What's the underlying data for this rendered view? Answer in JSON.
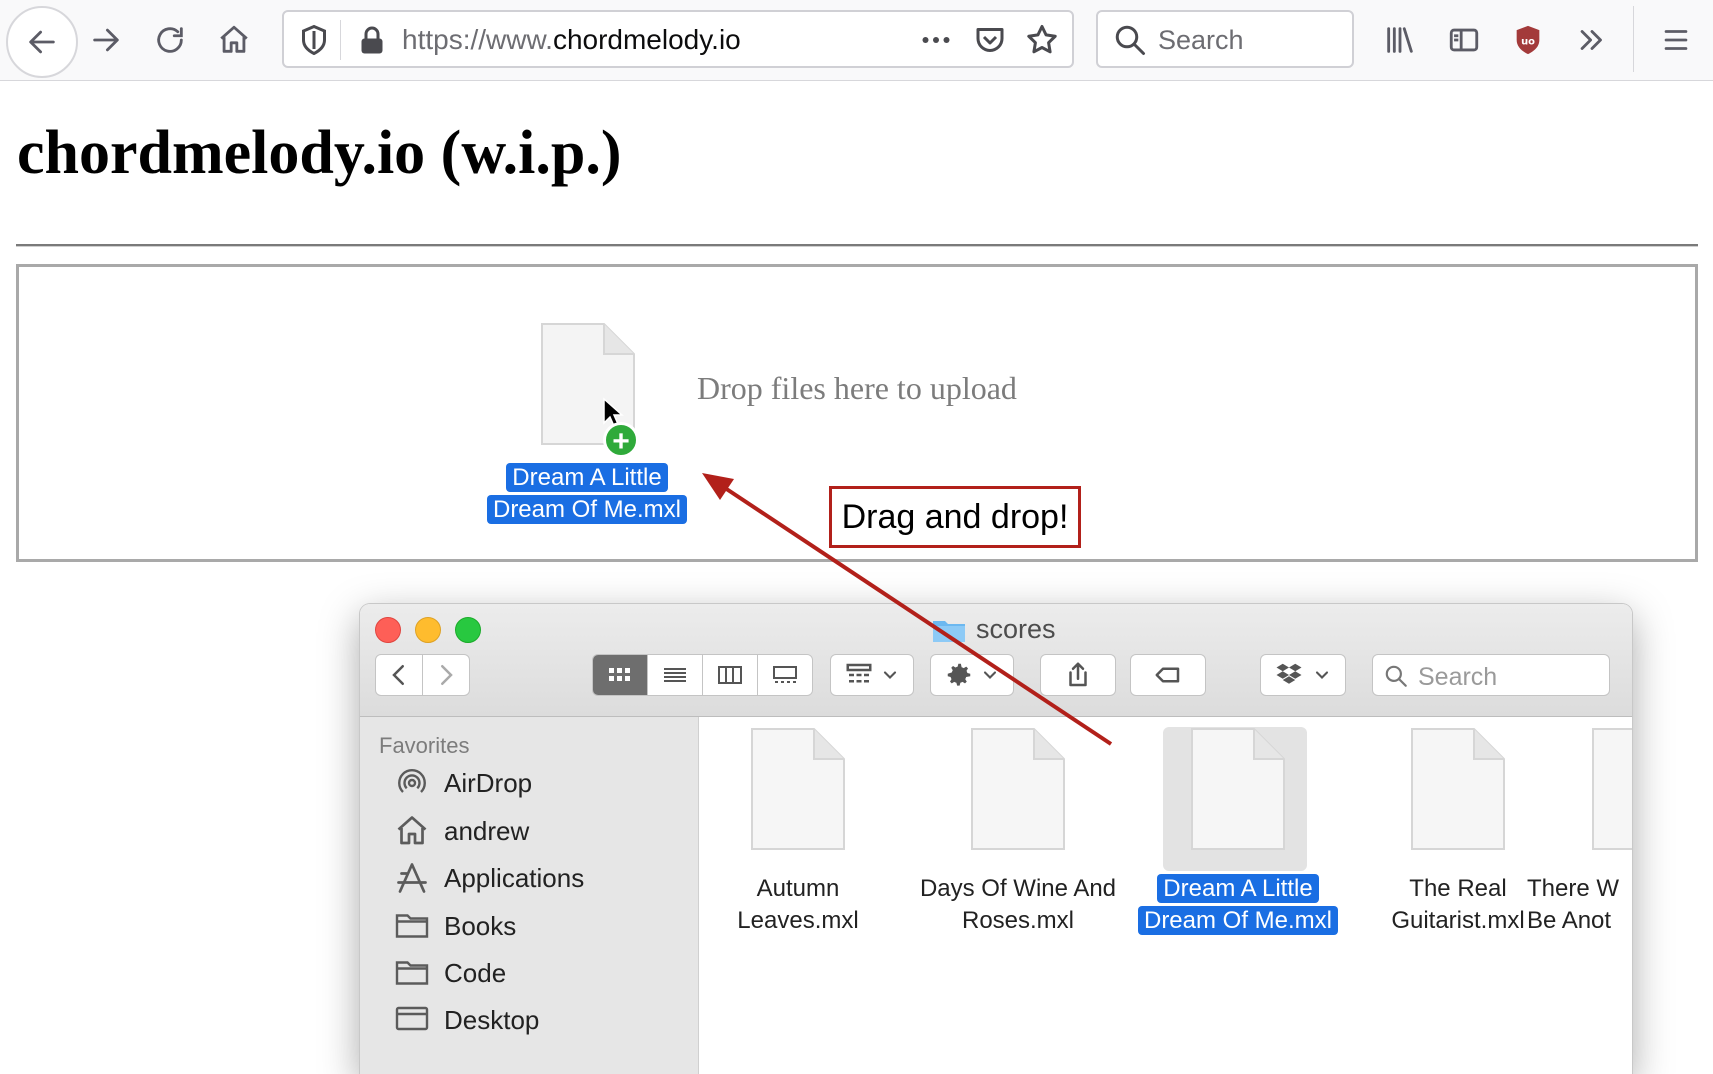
{
  "browser": {
    "url_scheme": "https://www.",
    "url_domain": "chordmelody.io",
    "search_placeholder": "Search",
    "icons": [
      "back-icon",
      "forward-icon",
      "reload-icon",
      "home-icon",
      "shield-icon",
      "lock-icon",
      "more-icon",
      "pocket-icon",
      "star-icon",
      "library-icon",
      "sidebar-icon",
      "ublock-icon",
      "overflow-icon",
      "menu-icon"
    ]
  },
  "page": {
    "title": "chordmelody.io (w.i.p.)",
    "drop_text": "Drop files here to upload",
    "dragged_file_line1": "Dream A Little",
    "dragged_file_line2": "Dream Of Me.mxl",
    "callout": "Drag and drop!",
    "accent": "#b2201a",
    "selection_color": "#1a6ee3"
  },
  "finder": {
    "title": "scores",
    "search_placeholder": "Search",
    "sidebar_heading": "Favorites",
    "sidebar_items": [
      {
        "label": "AirDrop",
        "icon": "airdrop-icon"
      },
      {
        "label": "andrew",
        "icon": "home-icon"
      },
      {
        "label": "Applications",
        "icon": "applications-icon"
      },
      {
        "label": "Books",
        "icon": "folder-icon"
      },
      {
        "label": "Code",
        "icon": "folder-icon"
      },
      {
        "label": "Desktop",
        "icon": "desktop-icon"
      }
    ],
    "files": [
      {
        "line1": "Autumn",
        "line2": "Leaves.mxl",
        "selected": false
      },
      {
        "line1": "Days Of Wine And",
        "line2": "Roses.mxl",
        "selected": false
      },
      {
        "line1": "Dream A Little",
        "line2": "Dream Of Me.mxl",
        "selected": true
      },
      {
        "line1": "The Real",
        "line2": "Guitarist.mxl",
        "selected": false
      },
      {
        "line1": "There W",
        "line2": "Be Anot",
        "selected": false
      }
    ]
  }
}
